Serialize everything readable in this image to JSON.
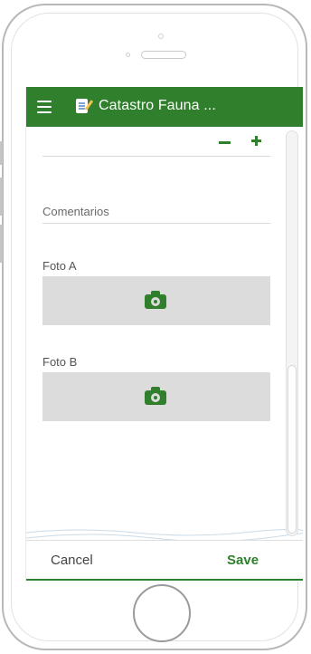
{
  "app_bar": {
    "title": "Catastro Fauna ...",
    "menu_icon": "hamburger-menu-icon",
    "app_icon": "notepad-edit-icon",
    "color": "#2f7f2c"
  },
  "form": {
    "stepper": {
      "value": "",
      "minus_icon": "minus-icon",
      "plus_icon": "plus-icon"
    },
    "comments": {
      "placeholder": "Comentarios",
      "value": ""
    },
    "photos": [
      {
        "label": "Foto A",
        "icon": "camera-icon"
      },
      {
        "label": "Foto B",
        "icon": "camera-icon"
      }
    ]
  },
  "footer": {
    "cancel_label": "Cancel",
    "save_label": "Save"
  },
  "colors": {
    "accent": "#2f7f2c",
    "photo_box": "#dcdcdc"
  }
}
